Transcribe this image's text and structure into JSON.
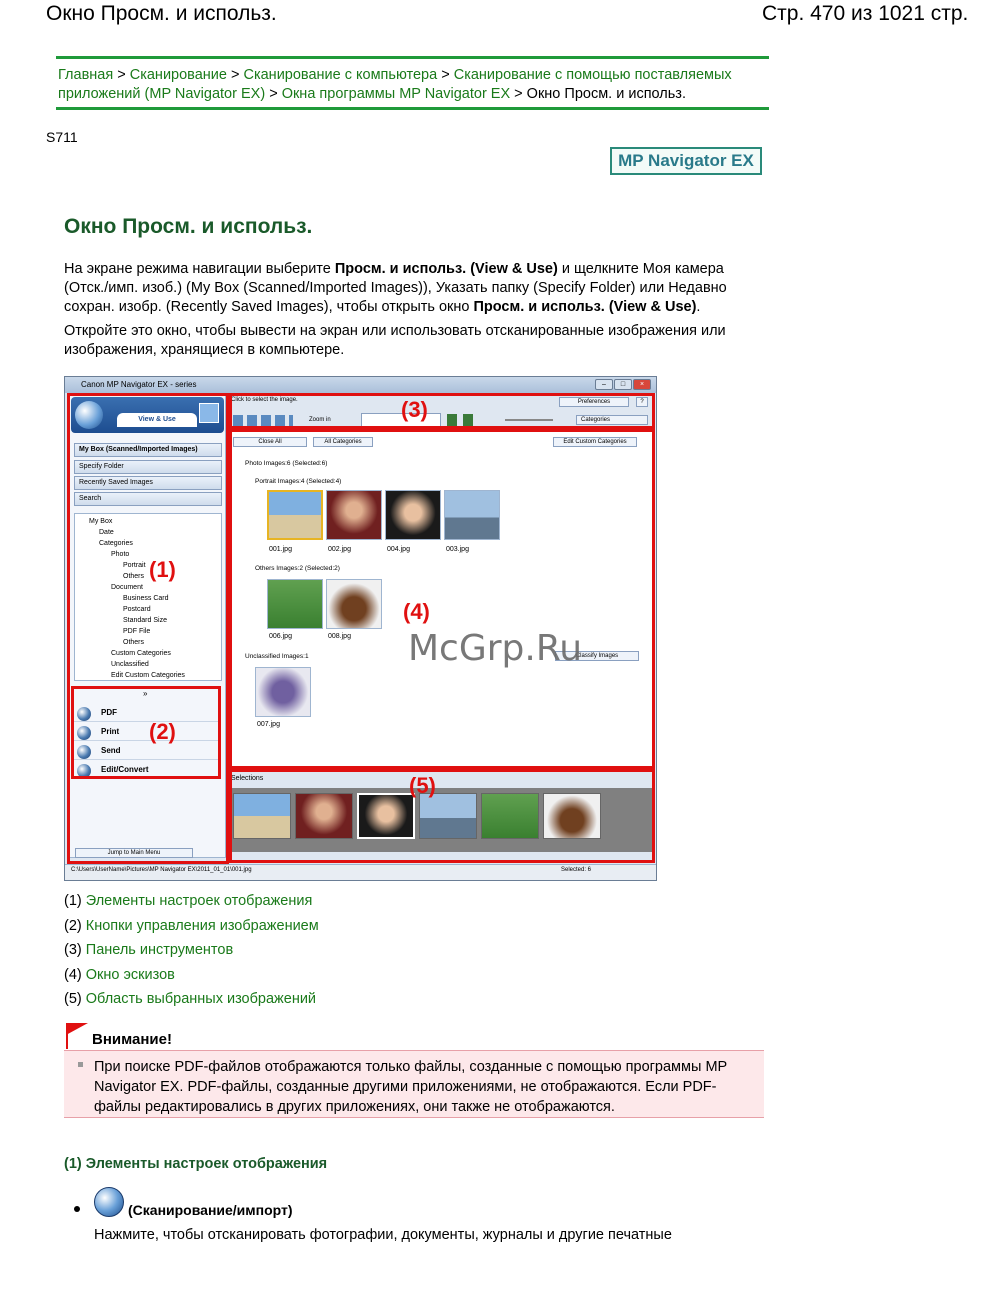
{
  "header": {
    "left": "Окно Просм. и использ.",
    "right": "Стр. 470 из 1021 стр."
  },
  "breadcrumb": {
    "items": [
      "Главная",
      "Сканирование",
      "Сканирование с компьютера",
      "Сканирование с помощью поставляемых",
      "приложений (MP Navigator EX)",
      "Окна программы MP Navigator EX"
    ],
    "current": "Окно Просм. и использ.",
    "sep": ">"
  },
  "code": "S711",
  "logo": "MP Navigator EX",
  "title": "Окно Просм. и использ.",
  "para1": {
    "l1a": "На экране режима навигации выберите ",
    "l1b": "Просм. и использ. (View & Use)",
    "l1c": " и щелкните Моя камера",
    "l2": "(Отск./имп. изоб.) (My Box (Scanned/Imported Images)), Указать папку (Specify Folder) или Недавно",
    "l3a": "сохран. изобр. (Recently Saved Images), чтобы открыть окно ",
    "l3b": "Просм. и использ. (View & Use)",
    "l3c": "."
  },
  "para2": {
    "l1": "Откройте это окно, чтобы вывести на экран или использовать отсканированные изображения или",
    "l2": "изображения, хранящиеся в компьютере."
  },
  "screenshot": {
    "window_title": "Canon MP Navigator EX - series",
    "view_use": "View & Use",
    "nav": [
      "My Box (Scanned/Imported Images)",
      "Specify Folder",
      "Recently Saved Images",
      "Search"
    ],
    "tree": [
      "My Box",
      "Date",
      "Categories",
      "Photo",
      "Portrait",
      "Others",
      "Document",
      "Business Card",
      "Postcard",
      "Standard Size",
      "PDF File",
      "Others",
      "Custom Categories",
      "Unclassified",
      "Edit Custom Categories"
    ],
    "actions": [
      "PDF",
      "Print",
      "Send",
      "Edit/Convert"
    ],
    "jump": "Jump to Main Menu",
    "click_select": "Click to select the image.",
    "preferences": "Preferences",
    "help": "?",
    "zoom": "Zoom in",
    "categories_dd": "Categories",
    "close_all": "Close All",
    "all_categories": "All Categories",
    "edit_custom": "Edit Custom Categories",
    "g_photo": "Photo  Images:6  (Selected:6)",
    "g_portrait": "Portrait  Images:4  (Selected:4)",
    "g_others": "Others  Images:2  (Selected:2)",
    "g_unclass": "Unclassified  Images:1",
    "classify": "Classify Images",
    "files": [
      "001.jpg",
      "002.jpg",
      "004.jpg",
      "003.jpg",
      "006.jpg",
      "008.jpg",
      "007.jpg"
    ],
    "selections": "Selections",
    "status_path": "C:\\Users\\UserName\\Pictures\\MP Navigator EX\\2011_01_01\\001.jpg",
    "status_sel": "Selected: 6",
    "labels": [
      "(1)",
      "(2)",
      "(3)",
      "(4)",
      "(5)"
    ]
  },
  "legend": [
    {
      "num": "(1)",
      "text": "Элементы настроек отображения"
    },
    {
      "num": "(2)",
      "text": "Кнопки управления изображением"
    },
    {
      "num": "(3)",
      "text": "Панель инструментов"
    },
    {
      "num": "(4)",
      "text": "Окно эскизов"
    },
    {
      "num": "(5)",
      "text": "Область выбранных изображений"
    }
  ],
  "watermark": "McGrp.Ru",
  "warning": {
    "title": "Внимание!",
    "l1": "При поиске PDF-файлов отображаются только файлы, созданные с помощью программы MP",
    "l2": "Navigator EX. PDF-файлы, созданные другими приложениями, не отображаются. Если PDF-",
    "l3": "файлы редактировались в других приложениях, они также не отображаются."
  },
  "section1": {
    "heading": "(1) Элементы настроек отображения",
    "bullet_label": "(Сканирование/импорт)",
    "bullet_text": "Нажмите, чтобы отсканировать фотографии, документы, журналы и другие печатные"
  },
  "colors": {
    "link": "#1a7a1a",
    "rule": "#1f9a3a",
    "title": "#1a5a2a",
    "red": "#e01010",
    "warn_bg": "#fde8ea"
  }
}
